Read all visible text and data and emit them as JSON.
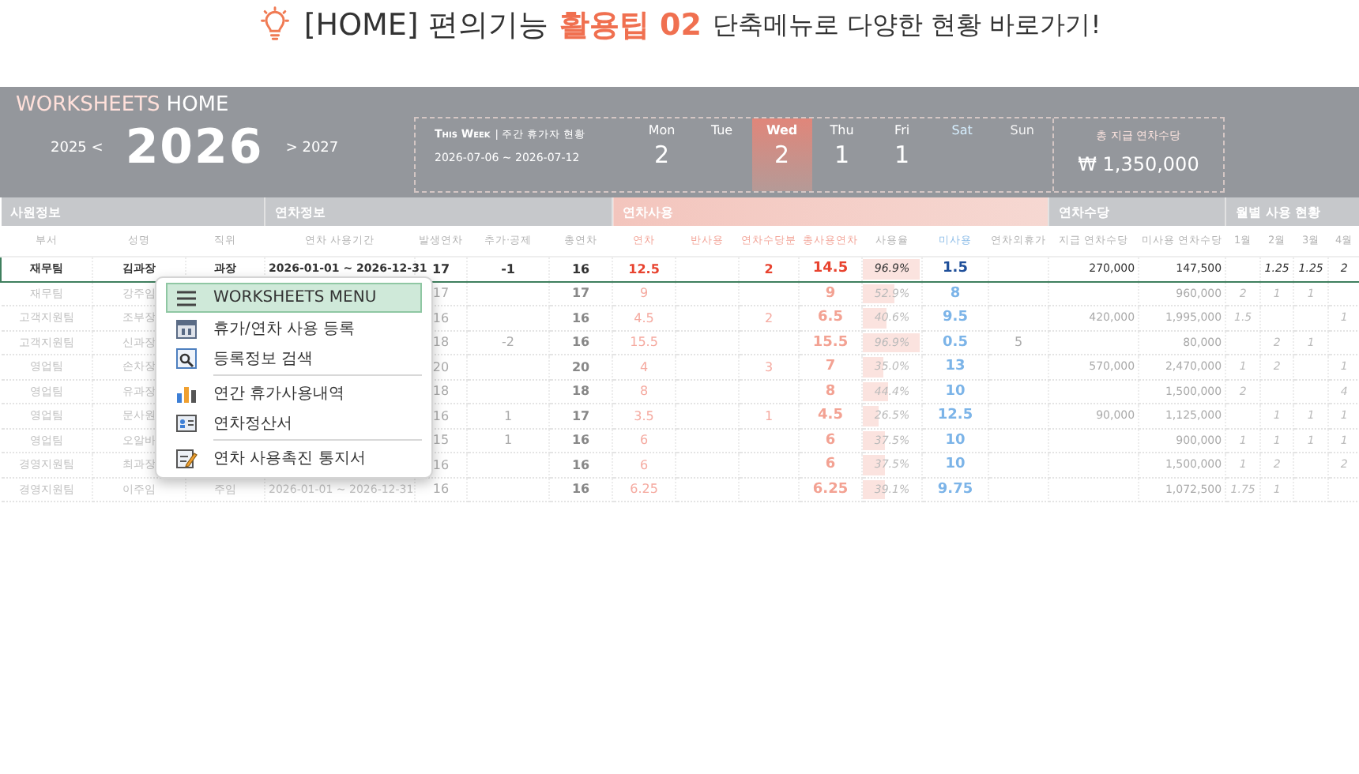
{
  "headline": {
    "prefix": "[HOME] 편의기능",
    "highlight": "활용팁 02",
    "suffix": "단축메뉴로 다양한 현황 바로가기!"
  },
  "home": {
    "brand": "WORKSHEETS",
    "brand_suffix": "HOME",
    "prev_year": "2025 <",
    "year": "2026",
    "next_year": "> 2027",
    "week": {
      "title": "This Week",
      "subtitle": "| 주간 휴가자 현황",
      "range": "2026-07-06 ~ 2026-07-12",
      "days": [
        {
          "label": "Mon",
          "count": "2",
          "kind": "weekday",
          "selected": false
        },
        {
          "label": "Tue",
          "kind": "weekday",
          "selected": false
        },
        {
          "label": "Wed",
          "count": "2",
          "kind": "weekday",
          "selected": true
        },
        {
          "label": "Thu",
          "count": "1",
          "kind": "weekday",
          "selected": false
        },
        {
          "label": "Fri",
          "count": "1",
          "kind": "weekday",
          "selected": false
        },
        {
          "label": "Sat",
          "kind": "saturday",
          "selected": false
        },
        {
          "label": "Sun",
          "kind": "sunday",
          "selected": false
        }
      ],
      "total_label": "총 지급 연차수당",
      "total": "₩ 1,350,000"
    }
  },
  "table": {
    "groups": [
      {
        "label": "사원정보",
        "kind": "plain",
        "columns": [
          {
            "label": "부서",
            "kind": "text"
          },
          {
            "label": "성명",
            "kind": "text"
          },
          {
            "label": "직위",
            "kind": "text"
          }
        ]
      },
      {
        "label": "연차정보",
        "kind": "plain",
        "columns": [
          {
            "label": "연차 사용기간",
            "kind": "text"
          },
          {
            "label": "발생연차",
            "kind": "number"
          },
          {
            "label": "추가·공제",
            "kind": "number"
          },
          {
            "label": "총연차",
            "kind": "bold"
          }
        ]
      },
      {
        "label": "연차사용",
        "kind": "usage",
        "columns": [
          {
            "label": "연차",
            "kind": "leave"
          },
          {
            "label": "반사용",
            "kind": "leave"
          },
          {
            "label": "연차수당분",
            "kind": "leave"
          },
          {
            "label": "총사용연차",
            "kind": "leave_bold"
          },
          {
            "label": "사용율",
            "kind": "rate"
          },
          {
            "label": "미사용",
            "kind": "unused"
          },
          {
            "label": "연차외휴가",
            "kind": "number"
          }
        ]
      },
      {
        "label": "연차수당",
        "kind": "plain",
        "columns": [
          {
            "label": "지급 연차수당",
            "kind": "money"
          },
          {
            "label": "미사용 연차수당",
            "kind": "money"
          }
        ]
      },
      {
        "label": "월별 사용 현황",
        "kind": "plain",
        "columns": [
          {
            "label": "1월",
            "kind": "month"
          },
          {
            "label": "2월",
            "kind": "month"
          },
          {
            "label": "3월",
            "kind": "month"
          },
          {
            "label": "4월",
            "kind": "month"
          }
        ]
      }
    ],
    "rows": [
      {
        "selected": true,
        "level": 0.969,
        "cells": [
          "재무팀",
          "김과장",
          "과장",
          "2026-01-01 ~ 2026-12-31",
          "17",
          "-1",
          "16",
          "12.5",
          "",
          "2",
          "14.5",
          "96.9%",
          "1.5",
          "",
          "270,000",
          "147,500",
          "",
          "1.25",
          "1.25",
          "2"
        ]
      },
      {
        "selected": false,
        "level": 0.529,
        "cells": [
          "재무팀",
          "강주임",
          "",
          "",
          "17",
          "",
          "17",
          "9",
          "",
          "",
          "9",
          "52.9%",
          "8",
          "",
          "",
          "960,000",
          "2",
          "1",
          "1",
          ""
        ]
      },
      {
        "selected": false,
        "level": 0.406,
        "cells": [
          "고객지원팀",
          "조부장",
          "",
          "",
          "16",
          "",
          "16",
          "4.5",
          "",
          "2",
          "6.5",
          "40.6%",
          "9.5",
          "",
          "420,000",
          "1,995,000",
          "1.5",
          "",
          "",
          "1"
        ]
      },
      {
        "selected": false,
        "level": 0.969,
        "cells": [
          "고객지원팀",
          "신과장",
          "",
          "",
          "18",
          "-2",
          "16",
          "15.5",
          "",
          "",
          "15.5",
          "96.9%",
          "0.5",
          "5",
          "",
          "80,000",
          "",
          "2",
          "1",
          ""
        ]
      },
      {
        "selected": false,
        "level": 0.35,
        "cells": [
          "영업팀",
          "손차장",
          "",
          "",
          "20",
          "",
          "20",
          "4",
          "",
          "3",
          "7",
          "35.0%",
          "13",
          "",
          "570,000",
          "2,470,000",
          "1",
          "2",
          "",
          "1"
        ]
      },
      {
        "selected": false,
        "level": 0.444,
        "cells": [
          "영업팀",
          "유과장",
          "",
          "",
          "18",
          "",
          "18",
          "8",
          "",
          "",
          "8",
          "44.4%",
          "10",
          "",
          "",
          "1,500,000",
          "2",
          "",
          "",
          "4"
        ]
      },
      {
        "selected": false,
        "level": 0.265,
        "cells": [
          "영업팀",
          "문사원",
          "",
          "",
          "16",
          "1",
          "17",
          "3.5",
          "",
          "1",
          "4.5",
          "26.5%",
          "12.5",
          "",
          "90,000",
          "1,125,000",
          "",
          "1",
          "1",
          "1"
        ]
      },
      {
        "selected": false,
        "level": 0.375,
        "cells": [
          "영업팀",
          "오알바",
          "",
          "",
          "15",
          "1",
          "16",
          "6",
          "",
          "",
          "6",
          "37.5%",
          "10",
          "",
          "",
          "900,000",
          "1",
          "1",
          "1",
          "1"
        ]
      },
      {
        "selected": false,
        "level": 0.375,
        "cells": [
          "경영지원팀",
          "최과장",
          "",
          "",
          "16",
          "",
          "16",
          "6",
          "",
          "",
          "6",
          "37.5%",
          "10",
          "",
          "",
          "1,500,000",
          "1",
          "2",
          "",
          "2"
        ]
      },
      {
        "selected": false,
        "level": 0.391,
        "cells": [
          "경영지원팀",
          "이주임",
          "주임",
          "2026-01-01 ~ 2026-12-31",
          "16",
          "",
          "16",
          "6.25",
          "",
          "",
          "6.25",
          "39.1%",
          "9.75",
          "",
          "",
          "1,072,500",
          "1.75",
          "1",
          "",
          ""
        ]
      }
    ]
  },
  "menu": {
    "items": [
      {
        "label": "WORKSHEETS MENU",
        "kind": "menu",
        "selected": true,
        "divider_after": false
      },
      {
        "label": "휴가/연차 사용 등록",
        "kind": "calendar",
        "selected": false,
        "divider_after": false
      },
      {
        "label": "등록정보 검색",
        "kind": "search",
        "selected": false,
        "divider_after": true
      },
      {
        "label": "연간 휴가사용내역",
        "kind": "chart",
        "selected": false,
        "divider_after": false
      },
      {
        "label": "연차정산서",
        "kind": "card",
        "selected": false,
        "divider_after": true
      },
      {
        "label": "연차 사용촉진 통지서",
        "kind": "notice",
        "selected": false,
        "divider_after": false
      }
    ]
  }
}
